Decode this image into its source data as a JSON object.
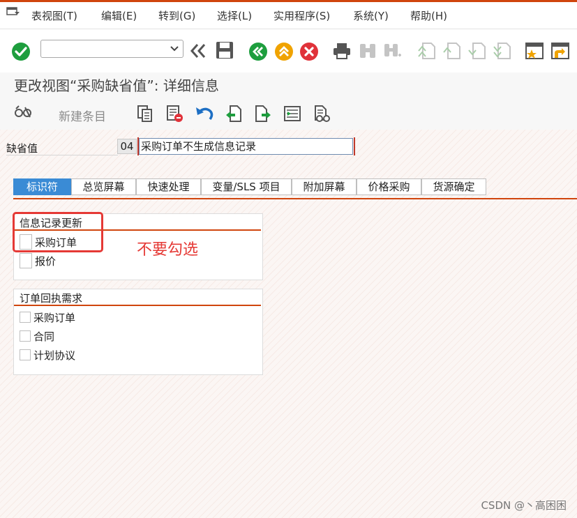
{
  "menubar": {
    "items": [
      "表视图(T)",
      "编辑(E)",
      "转到(G)",
      "选择(L)",
      "实用程序(S)",
      "系统(Y)",
      "帮助(H)"
    ]
  },
  "toolbar": {
    "icons": [
      "enter-check-icon",
      "command-field",
      "collapse-icon",
      "save-icon",
      "back-icon",
      "exit-icon",
      "cancel-icon",
      "print-icon",
      "find-icon",
      "find-next-icon",
      "first-page-icon",
      "prev-page-icon",
      "next-page-icon",
      "last-page-icon",
      "create-session-icon",
      "shortcut-icon"
    ],
    "colors": {
      "green": "#1e9e3e",
      "orange": "#f0a300",
      "red": "#e0323a",
      "disabled": "#b9c4b9"
    }
  },
  "title": "更改视图“采购缺省值”: 详细信息",
  "app_toolbar": {
    "new_entry": "新建条目"
  },
  "field": {
    "label": "缺省值",
    "key": "04",
    "value": "采购订单不生成信息记录"
  },
  "tabs": [
    "标识符",
    "总览屏幕",
    "快速处理",
    "变量/SLS 项目",
    "附加屏幕",
    "价格采购",
    "货源确定"
  ],
  "groups": {
    "info_record": {
      "title": "信息记录更新",
      "items": [
        "采购订单",
        "报价"
      ]
    },
    "ack": {
      "title": "订单回执需求",
      "items": [
        "采购订单",
        "合同",
        "计划协议"
      ]
    }
  },
  "annotation": "不要勾选",
  "watermark": "CSDN @丶高困困",
  "accent": "#d0450d",
  "tab_active_color": "#3a8bd5"
}
